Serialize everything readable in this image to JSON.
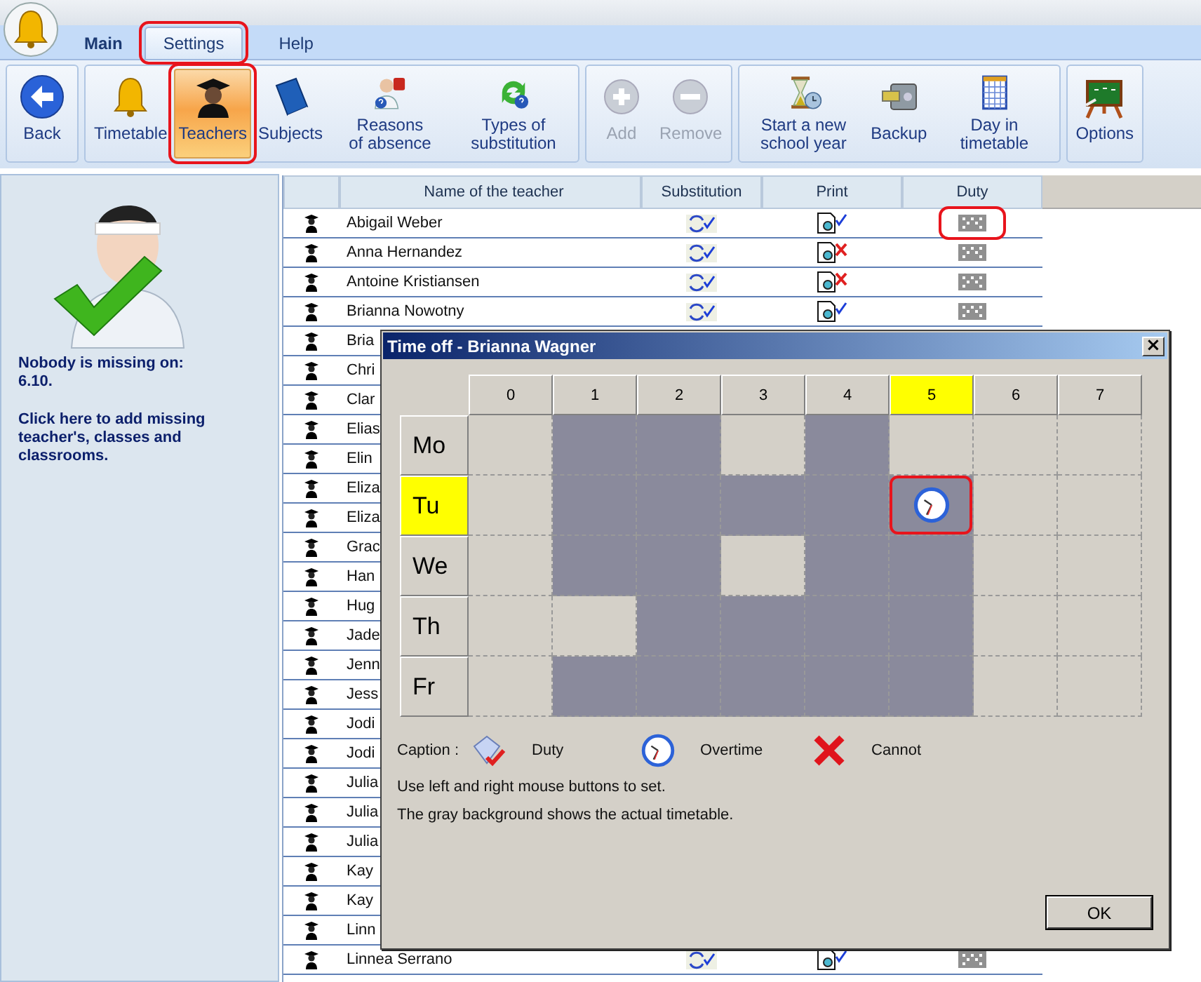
{
  "tabs": [
    {
      "label": "Main",
      "selected": false,
      "highlighted": false
    },
    {
      "label": "Settings",
      "selected": true,
      "highlighted": true
    },
    {
      "label": "Help",
      "selected": false,
      "highlighted": false
    }
  ],
  "ribbon": {
    "groups": [
      {
        "buttons": [
          {
            "label": "Back",
            "kind": "back",
            "disabled": false,
            "selected": false,
            "highlighted": false
          }
        ]
      },
      {
        "buttons": [
          {
            "label": "Timetable",
            "kind": "bell",
            "disabled": false,
            "selected": false,
            "highlighted": false
          },
          {
            "label": "Teachers",
            "kind": "teacher",
            "disabled": false,
            "selected": true,
            "highlighted": true
          },
          {
            "label": "Subjects",
            "kind": "book",
            "disabled": false,
            "selected": false,
            "highlighted": false
          },
          {
            "label": "Reasons of absence",
            "kind": "absence",
            "disabled": false,
            "selected": false,
            "highlighted": false
          },
          {
            "label": "Types of substitution",
            "kind": "cycle",
            "disabled": false,
            "selected": false,
            "highlighted": false
          }
        ]
      },
      {
        "buttons": [
          {
            "label": "Add",
            "kind": "add",
            "disabled": true,
            "selected": false,
            "highlighted": false
          },
          {
            "label": "Remove",
            "kind": "remove",
            "disabled": true,
            "selected": false,
            "highlighted": false
          }
        ]
      },
      {
        "buttons": [
          {
            "label": "Start a new school year",
            "kind": "hourglass",
            "disabled": false,
            "selected": false,
            "highlighted": false
          },
          {
            "label": "Backup",
            "kind": "safe",
            "disabled": false,
            "selected": false,
            "highlighted": false
          },
          {
            "label": "Day in timetable",
            "kind": "grid",
            "disabled": false,
            "selected": false,
            "highlighted": false
          }
        ]
      },
      {
        "buttons": [
          {
            "label": "Options",
            "kind": "board",
            "disabled": false,
            "selected": false,
            "highlighted": false
          }
        ]
      }
    ]
  },
  "sidebar": {
    "message": "Nobody is missing on:",
    "date": "6.10.",
    "link": "Click here to add missing teacher's, classes and classrooms."
  },
  "table": {
    "columns": [
      "Name of the teacher",
      "Substitution",
      "Print",
      "Duty"
    ],
    "rows": [
      {
        "name": "Abigail Weber",
        "substitution": true,
        "print_allowed": true,
        "duty": true,
        "highlighted": true
      },
      {
        "name": "Anna Hernandez",
        "substitution": true,
        "print_allowed": false,
        "duty": true
      },
      {
        "name": "Antoine Kristiansen",
        "substitution": true,
        "print_allowed": false,
        "duty": true
      },
      {
        "name": "Brianna Nowotny",
        "substitution": true,
        "print_allowed": true,
        "duty": true
      },
      {
        "name": "Bria"
      },
      {
        "name": "Chri"
      },
      {
        "name": "Clar"
      },
      {
        "name": "Elias"
      },
      {
        "name": "Elin"
      },
      {
        "name": "Eliza"
      },
      {
        "name": "Eliza"
      },
      {
        "name": "Grac"
      },
      {
        "name": "Han"
      },
      {
        "name": "Hug"
      },
      {
        "name": "Jade"
      },
      {
        "name": "Jenn"
      },
      {
        "name": "Jess"
      },
      {
        "name": "Jodi"
      },
      {
        "name": "Jodi"
      },
      {
        "name": "Julia"
      },
      {
        "name": "Julia"
      },
      {
        "name": "Julia"
      },
      {
        "name": "Kay"
      },
      {
        "name": "Kay"
      },
      {
        "name": "Linn"
      },
      {
        "name": "Linnea Serrano",
        "substitution": true,
        "print_allowed": true,
        "duty": true
      }
    ]
  },
  "dialog": {
    "title": "Time off - Brianna Wagner",
    "close": "×",
    "hours": [
      {
        "label": "0",
        "selected": false
      },
      {
        "label": "1",
        "selected": false
      },
      {
        "label": "2",
        "selected": false
      },
      {
        "label": "3",
        "selected": false
      },
      {
        "label": "4",
        "selected": false
      },
      {
        "label": "5",
        "selected": true
      },
      {
        "label": "6",
        "selected": false
      },
      {
        "label": "7",
        "selected": false
      }
    ],
    "days": [
      {
        "label": "Mo",
        "selected": false,
        "cells": [
          {
            "busy": false
          },
          {
            "busy": true
          },
          {
            "busy": true
          },
          {
            "busy": false
          },
          {
            "busy": true
          },
          {
            "busy": false
          },
          {
            "busy": false
          },
          {
            "busy": false
          }
        ]
      },
      {
        "label": "Tu",
        "selected": true,
        "cells": [
          {
            "busy": false
          },
          {
            "busy": true
          },
          {
            "busy": true
          },
          {
            "busy": true
          },
          {
            "busy": true
          },
          {
            "busy": true,
            "overtime": true,
            "highlighted": true
          },
          {
            "busy": false
          },
          {
            "busy": false
          }
        ]
      },
      {
        "label": "We",
        "selected": false,
        "cells": [
          {
            "busy": false
          },
          {
            "busy": true
          },
          {
            "busy": true
          },
          {
            "busy": false
          },
          {
            "busy": true
          },
          {
            "busy": true
          },
          {
            "busy": false
          },
          {
            "busy": false
          }
        ]
      },
      {
        "label": "Th",
        "selected": false,
        "cells": [
          {
            "busy": false
          },
          {
            "busy": false
          },
          {
            "busy": true
          },
          {
            "busy": true
          },
          {
            "busy": true
          },
          {
            "busy": true
          },
          {
            "busy": false
          },
          {
            "busy": false
          }
        ]
      },
      {
        "label": "Fr",
        "selected": false,
        "cells": [
          {
            "busy": false
          },
          {
            "busy": true
          },
          {
            "busy": true
          },
          {
            "busy": true
          },
          {
            "busy": true
          },
          {
            "busy": true
          },
          {
            "busy": false
          },
          {
            "busy": false
          }
        ]
      }
    ],
    "caption_label": "Caption :",
    "legend": [
      {
        "kind": "duty",
        "label": "Duty"
      },
      {
        "kind": "overtime",
        "label": "Overtime"
      },
      {
        "kind": "cannot",
        "label": "Cannot"
      }
    ],
    "notes": [
      "Use left and right mouse buttons to set.",
      "The gray background shows the actual timetable."
    ],
    "ok": "OK"
  }
}
